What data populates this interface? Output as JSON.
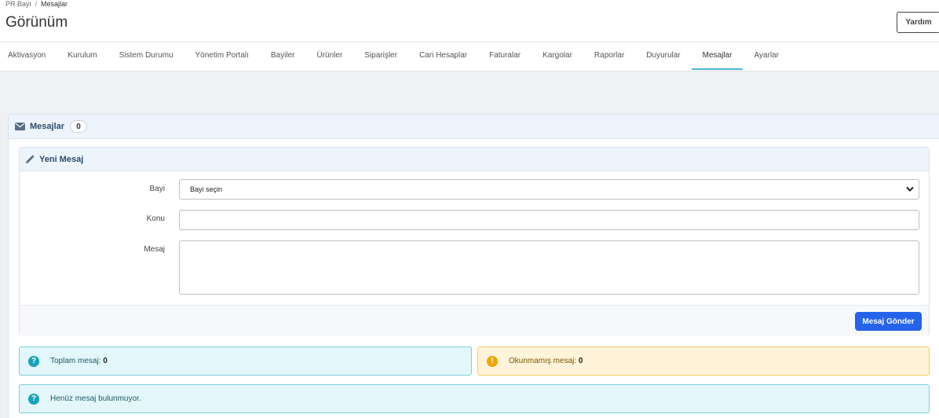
{
  "breadcrumb": {
    "root": "PR Bayi",
    "separator": "/",
    "current": "Mesajlar"
  },
  "header": {
    "title": "Görünüm",
    "help_label": "Yardım"
  },
  "tabs": [
    {
      "label": "Aktivasyon"
    },
    {
      "label": "Kurulum"
    },
    {
      "label": "Sistem Durumu"
    },
    {
      "label": "Yönetim Portalı"
    },
    {
      "label": "Bayiler"
    },
    {
      "label": "Ürünler"
    },
    {
      "label": "Siparişler"
    },
    {
      "label": "Cari Hesaplar"
    },
    {
      "label": "Faturalar"
    },
    {
      "label": "Kargolar"
    },
    {
      "label": "Raporlar"
    },
    {
      "label": "Duyurular"
    },
    {
      "label": "Mesajlar",
      "active": true
    },
    {
      "label": "Ayarlar"
    }
  ],
  "messages_panel": {
    "title": "Mesajlar",
    "count": "0",
    "icon": "envelope-icon"
  },
  "new_message": {
    "title": "Yeni Mesaj",
    "icon": "pencil-icon",
    "dealer_label": "Bayi",
    "dealer_select_value": "Bayi seçin",
    "subject_label": "Konu",
    "subject_value": "",
    "message_label": "Mesaj",
    "message_value": "",
    "send_label": "Mesaj Gönder"
  },
  "stats": {
    "total_label": "Toplam mesaj:",
    "total_value": "0",
    "unread_label": "Okunmamış mesaj:",
    "unread_value": "0"
  },
  "empty_notice": "Henüz mesaj bulunmuyor.",
  "colors": {
    "accent": "#2563eb",
    "tab_active": "#4fb3d9",
    "info": "#17a2b8",
    "warning": "#f0a500"
  }
}
